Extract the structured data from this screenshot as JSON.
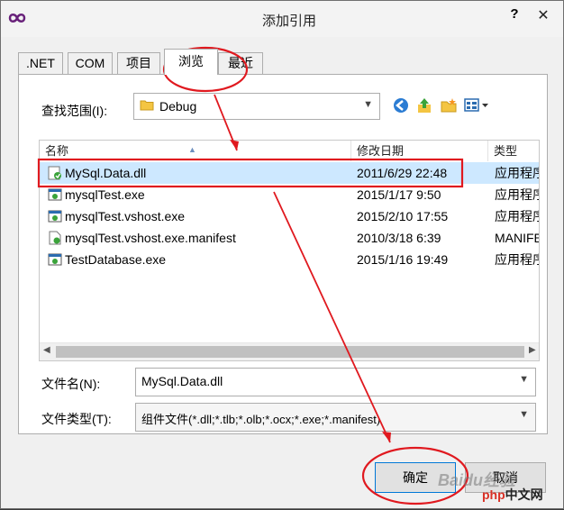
{
  "window": {
    "title": "添加引用"
  },
  "titlebar": {
    "help": "?",
    "close": "✕"
  },
  "tabs": [
    {
      "label": ".NET"
    },
    {
      "label": "COM"
    },
    {
      "label": "项目"
    },
    {
      "label": "浏览"
    },
    {
      "label": "最近"
    }
  ],
  "lookin": {
    "label": "查找范围(I):",
    "value": "Debug"
  },
  "columns": {
    "name": "名称",
    "date": "修改日期",
    "type": "类型"
  },
  "files": [
    {
      "name": "MySql.Data.dll",
      "date": "2011/6/29 22:48",
      "type": "应用程序扩展",
      "icon": "dll-icon"
    },
    {
      "name": "mysqlTest.exe",
      "date": "2015/1/17 9:50",
      "type": "应用程序",
      "icon": "exe-icon"
    },
    {
      "name": "mysqlTest.vshost.exe",
      "date": "2015/2/10 17:55",
      "type": "应用程序",
      "icon": "exe-icon"
    },
    {
      "name": "mysqlTest.vshost.exe.manifest",
      "date": "2010/3/18 6:39",
      "type": "MANIFEST",
      "icon": "manifest-icon"
    },
    {
      "name": "TestDatabase.exe",
      "date": "2015/1/16 19:49",
      "type": "应用程序",
      "icon": "exe-icon"
    }
  ],
  "filename": {
    "label": "文件名(N):",
    "value": "MySql.Data.dll"
  },
  "filetype": {
    "label": "文件类型(T):",
    "value": "组件文件(*.dll;*.tlb;*.olb;*.ocx;*.exe;*.manifest)"
  },
  "buttons": {
    "ok": "确定",
    "cancel": "取消"
  },
  "watermark": {
    "text": "Baidu经验",
    "logo_mark": "php",
    "logo_rest": "中文网"
  },
  "colors": {
    "selection": "#cde8ff",
    "annotation": "#e0191f",
    "accent": "#0078d7"
  }
}
